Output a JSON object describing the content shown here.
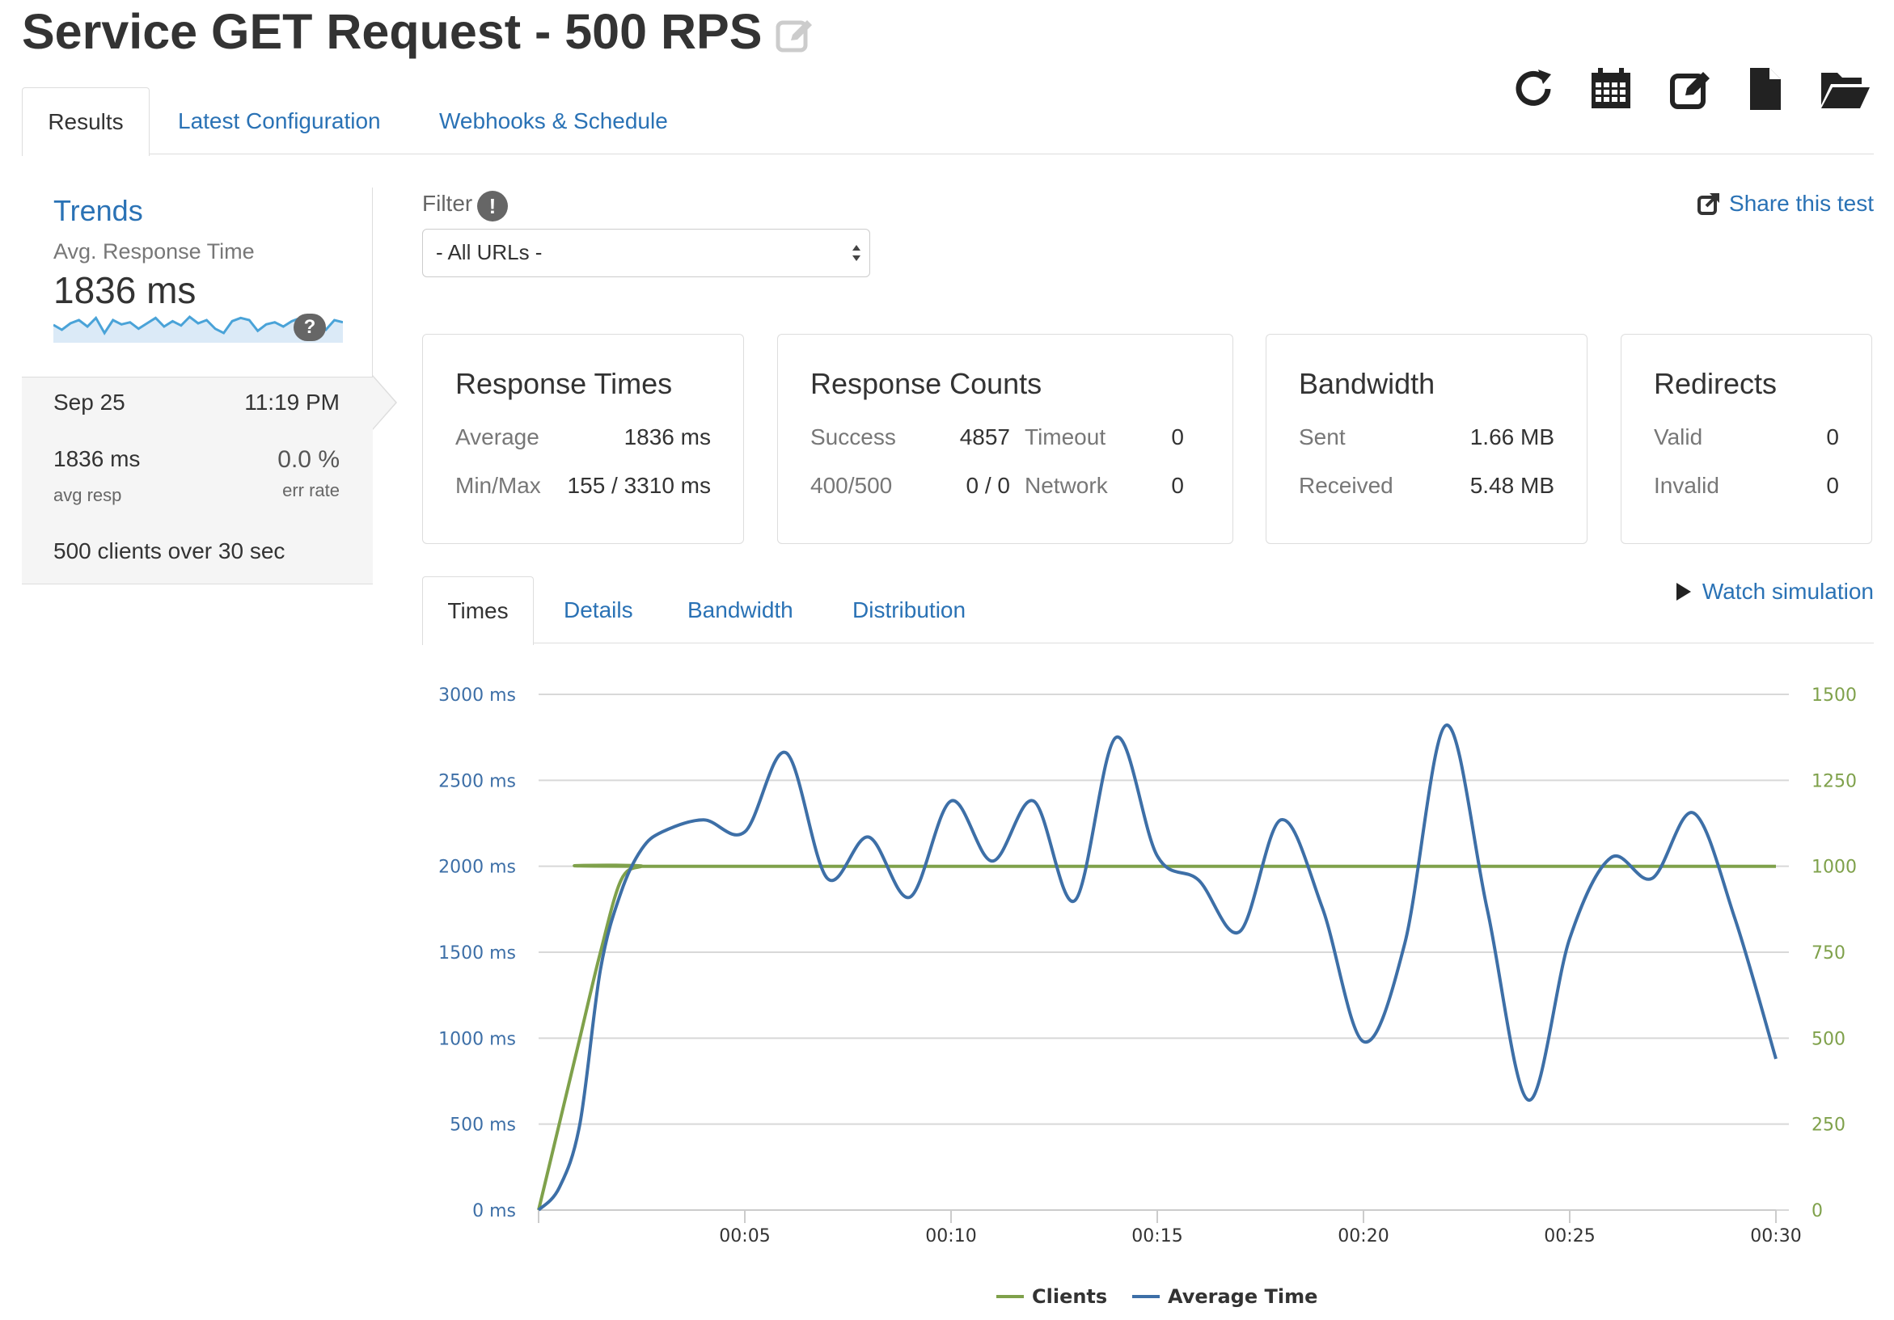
{
  "page": {
    "title": "Service GET Request - 500 RPS"
  },
  "toolbar": {
    "icons": [
      "refresh-icon",
      "calendar-icon",
      "edit-icon",
      "file-icon",
      "folder-open-icon"
    ]
  },
  "tabs": [
    {
      "label": "Results",
      "active": true
    },
    {
      "label": "Latest Configuration",
      "active": false
    },
    {
      "label": "Webhooks & Schedule",
      "active": false
    }
  ],
  "sidebar": {
    "trends_label": "Trends",
    "metric_label": "Avg. Response Time",
    "metric_value": "1836 ms",
    "help": "?",
    "run": {
      "date": "Sep 25",
      "time": "11:19 PM",
      "avg_resp_value": "1836 ms",
      "avg_resp_label": "avg resp",
      "err_rate_value": "0.0 %",
      "err_rate_label": "err rate",
      "clients_count": "500",
      "clients_mid": "clients over",
      "duration": "30",
      "duration_unit": "sec"
    }
  },
  "filter": {
    "label": "Filter",
    "info": "!",
    "selected": "- All URLs -"
  },
  "share_label": "Share this test",
  "panels": {
    "response_times": {
      "title": "Response Times",
      "average_label": "Average",
      "average_value": "1836 ms",
      "minmax_label": "Min/Max",
      "minmax_value": "155 / 3310 ms"
    },
    "response_counts": {
      "title": "Response Counts",
      "success_label": "Success",
      "success_value": "4857",
      "timeout_label": "Timeout",
      "timeout_value": "0",
      "errors_label": "400/500",
      "errors_value": "0 / 0",
      "network_label": "Network",
      "network_value": "0"
    },
    "bandwidth": {
      "title": "Bandwidth",
      "sent_label": "Sent",
      "sent_value": "1.66 MB",
      "received_label": "Received",
      "received_value": "5.48 MB"
    },
    "redirects": {
      "title": "Redirects",
      "valid_label": "Valid",
      "valid_value": "0",
      "invalid_label": "Invalid",
      "invalid_value": "0"
    }
  },
  "chart_tabs": [
    {
      "label": "Times",
      "active": true
    },
    {
      "label": "Details",
      "active": false
    },
    {
      "label": "Bandwidth",
      "active": false
    },
    {
      "label": "Distribution",
      "active": false
    }
  ],
  "watch_label": "Watch simulation",
  "colors": {
    "link": "#2a72b5",
    "clients": "#7fa14b",
    "avg_time": "#3d6fa7",
    "sparkline": "#4aa3d8"
  },
  "sparkline_values": [
    1836,
    1790,
    1850,
    1880,
    1820,
    1900,
    1760,
    1880,
    1840,
    1860,
    1800,
    1850,
    1900,
    1820,
    1870,
    1830,
    1910,
    1850,
    1880,
    1800,
    1760,
    1870,
    1900,
    1880,
    1780,
    1840,
    1860,
    1820,
    1870,
    1900,
    1840,
    1830,
    1790,
    1880,
    1860
  ],
  "chart_data": {
    "type": "line",
    "x_ticks": [
      "00:05",
      "00:10",
      "00:15",
      "00:20",
      "00:25",
      "00:30"
    ],
    "x_tick_seconds": [
      5,
      10,
      15,
      20,
      25,
      30
    ],
    "xlim": [
      0,
      30
    ],
    "y_left_ticks": [
      "0 ms",
      "500 ms",
      "1000 ms",
      "1500 ms",
      "2000 ms",
      "2500 ms",
      "3000 ms"
    ],
    "y_left_ticks_values": [
      0,
      500,
      1000,
      1500,
      2000,
      2500,
      3000
    ],
    "y_left_lim": [
      0,
      3000
    ],
    "y_right_ticks": [
      "0",
      "250",
      "500",
      "750",
      "1000",
      "1250",
      "1500"
    ],
    "y_right_ticks_values": [
      0,
      250,
      500,
      750,
      1000,
      1250,
      1500
    ],
    "y_right_lim": [
      0,
      1500
    ],
    "grid": true,
    "legend_position": "bottom",
    "series": [
      {
        "name": "Clients",
        "axis": "right",
        "x": [
          0,
          0.5,
          1.0,
          1.5,
          2.0,
          2.5,
          3.0,
          30
        ],
        "values": [
          0,
          250,
          500,
          750,
          960,
          1000,
          1000,
          1000
        ]
      },
      {
        "name": "Average Time",
        "axis": "left",
        "x": [
          0,
          0.5,
          1.0,
          1.5,
          2.0,
          2.5,
          3.0,
          4.0,
          5.0,
          6.0,
          7.0,
          8.0,
          9.0,
          10.0,
          11.0,
          12.0,
          13.0,
          14.0,
          15.0,
          16.0,
          17.0,
          18.0,
          19.0,
          20.0,
          21.0,
          22.0,
          23.0,
          24.0,
          25.0,
          26.0,
          27.0,
          28.0,
          29.0,
          30.0
        ],
        "values": [
          0,
          130,
          500,
          1400,
          1850,
          2100,
          2200,
          2270,
          2200,
          2660,
          1930,
          2170,
          1820,
          2380,
          2030,
          2380,
          1800,
          2750,
          2060,
          1920,
          1620,
          2270,
          1760,
          980,
          1550,
          2820,
          1750,
          640,
          1580,
          2050,
          1930,
          2310,
          1700,
          880
        ]
      }
    ]
  }
}
